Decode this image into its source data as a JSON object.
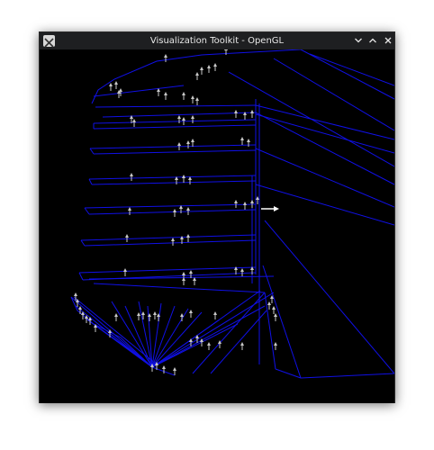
{
  "window": {
    "title": "Visualization Toolkit - OpenGL"
  },
  "icons": {
    "app": "x11-app-icon",
    "minimize": "chevron-down-icon",
    "maximize": "chevron-up-icon",
    "close": "close-icon"
  },
  "colors": {
    "background": "#000000",
    "mesh": "#1010e6",
    "glyphs": "#c8c8c8",
    "highlight_arrow": "#ffffff"
  }
}
